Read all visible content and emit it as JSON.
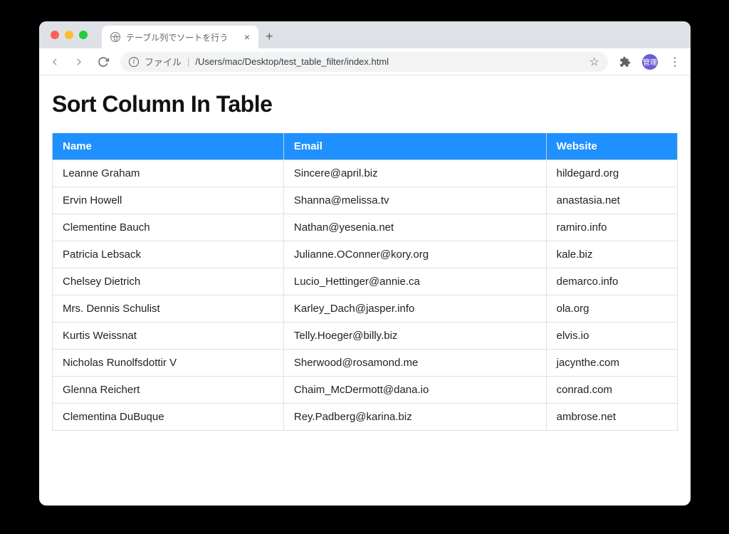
{
  "browser": {
    "tab_title": "テーブル列でソートを行う",
    "url_label": "ファイル",
    "url_path": "/Users/mac/Desktop/test_table_filter/index.html",
    "avatar_text": "管理"
  },
  "page": {
    "heading": "Sort Column In Table"
  },
  "table": {
    "headers": {
      "name": "Name",
      "email": "Email",
      "website": "Website"
    },
    "rows": [
      {
        "name": "Leanne Graham",
        "email": "Sincere@april.biz",
        "website": "hildegard.org"
      },
      {
        "name": "Ervin Howell",
        "email": "Shanna@melissa.tv",
        "website": "anastasia.net"
      },
      {
        "name": "Clementine Bauch",
        "email": "Nathan@yesenia.net",
        "website": "ramiro.info"
      },
      {
        "name": "Patricia Lebsack",
        "email": "Julianne.OConner@kory.org",
        "website": "kale.biz"
      },
      {
        "name": "Chelsey Dietrich",
        "email": "Lucio_Hettinger@annie.ca",
        "website": "demarco.info"
      },
      {
        "name": "Mrs. Dennis Schulist",
        "email": "Karley_Dach@jasper.info",
        "website": "ola.org"
      },
      {
        "name": "Kurtis Weissnat",
        "email": "Telly.Hoeger@billy.biz",
        "website": "elvis.io"
      },
      {
        "name": "Nicholas Runolfsdottir V",
        "email": "Sherwood@rosamond.me",
        "website": "jacynthe.com"
      },
      {
        "name": "Glenna Reichert",
        "email": "Chaim_McDermott@dana.io",
        "website": "conrad.com"
      },
      {
        "name": "Clementina DuBuque",
        "email": "Rey.Padberg@karina.biz",
        "website": "ambrose.net"
      }
    ]
  }
}
